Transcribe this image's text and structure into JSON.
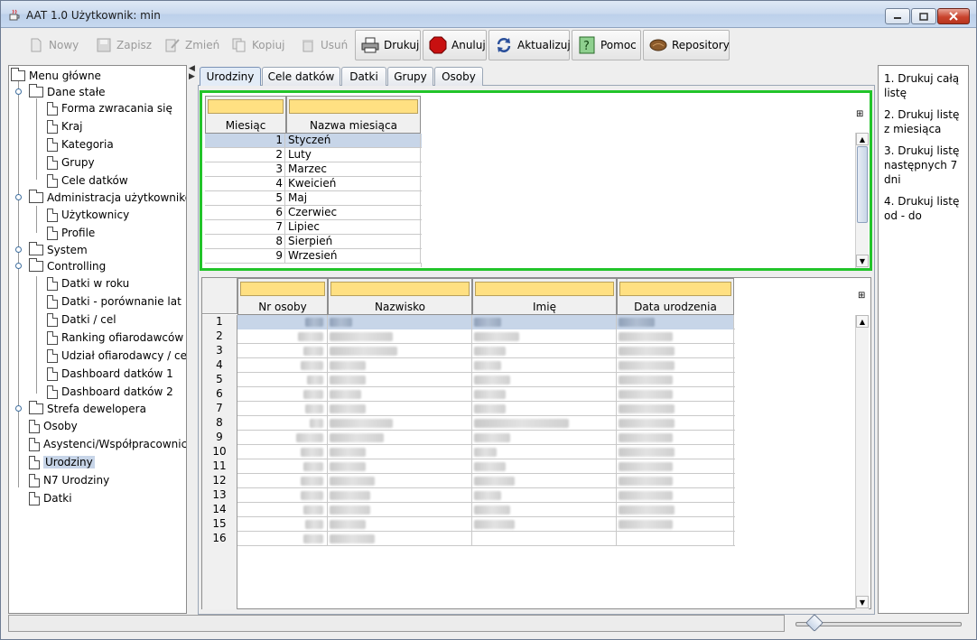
{
  "window": {
    "title": "AAT 1.0  Użytkownik: min"
  },
  "toolbar": {
    "new": "Nowy",
    "save": "Zapisz",
    "edit": "Zmień",
    "copy": "Kopiuj",
    "delete": "Usuń",
    "print": "Drukuj",
    "cancel": "Anuluj",
    "refresh": "Aktualizuj",
    "help": "Pomoc",
    "repository": "Repository"
  },
  "tree": {
    "root": "Menu główne",
    "dane_stale": "Dane stałe",
    "forma": "Forma zwracania się",
    "kraj": "Kraj",
    "kategoria": "Kategoria",
    "grupy": "Grupy",
    "cele": "Cele datków",
    "admin": "Administracja użytkowników",
    "uzytkownicy": "Użytkownicy",
    "profile": "Profile",
    "system": "System",
    "controlling": "Controlling",
    "datki_w_roku": "Datki w roku",
    "datki_porownanie": "Datki - porównanie lat",
    "datki_cel": "Datki / cel",
    "ranking": "Ranking ofiarodawców",
    "udzial": "Udział ofiarodawcy / cel",
    "dashboard1": "Dashboard datków 1",
    "dashboard2": "Dashboard datków 2",
    "strefa": "Strefa dewelopera",
    "osoby": "Osoby",
    "asystenci": "Asystenci/Współpracownicy",
    "urodziny": "Urodziny",
    "n7": "N7 Urodziny",
    "datki": "Datki"
  },
  "tabs": [
    "Urodziny",
    "Cele datków",
    "Datki",
    "Grupy",
    "Osoby"
  ],
  "months_table": {
    "col1": "Miesiąc",
    "col2": "Nazwa miesiąca",
    "rows": [
      {
        "n": "1",
        "name": "Styczeń"
      },
      {
        "n": "2",
        "name": "Luty"
      },
      {
        "n": "3",
        "name": "Marzec"
      },
      {
        "n": "4",
        "name": "Kweicień"
      },
      {
        "n": "5",
        "name": "Maj"
      },
      {
        "n": "6",
        "name": "Czerwiec"
      },
      {
        "n": "7",
        "name": "Lipiec"
      },
      {
        "n": "8",
        "name": "Sierpień"
      },
      {
        "n": "9",
        "name": "Wrzesień"
      }
    ]
  },
  "people_table": {
    "col1": "Nr osoby",
    "col2": "Nazwisko",
    "col3": "Imię",
    "col4": "Data urodzenia",
    "row_numbers": [
      "1",
      "2",
      "3",
      "4",
      "5",
      "6",
      "7",
      "8",
      "9",
      "10",
      "11",
      "12",
      "13",
      "14",
      "15",
      "16"
    ]
  },
  "right_panel": {
    "item1": "1. Drukuj całą listę",
    "item2": "2. Drukuj listę z miesiąca",
    "item3": "3. Drukuj listę następnych 7 dni",
    "item4": "4. Drukuj listę od - do"
  }
}
